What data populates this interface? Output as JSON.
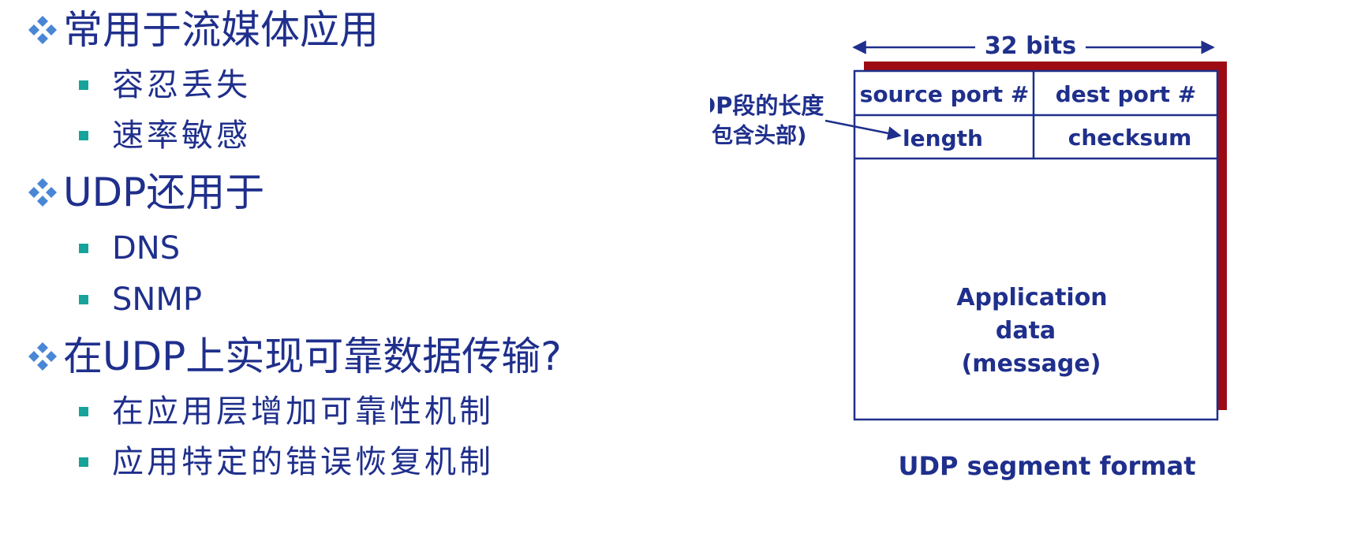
{
  "bullets": [
    {
      "text": "常用于流媒体应用",
      "children": [
        "容忍丢失",
        "速率敏感"
      ]
    },
    {
      "text": "UDP还用于",
      "children": [
        "DNS",
        "SNMP"
      ]
    },
    {
      "text": "在UDP上实现可靠数据传输?",
      "children": [
        "在应用层增加可靠性机制",
        "应用特定的错误恢复机制"
      ]
    }
  ],
  "diagram": {
    "width_label": "32 bits",
    "fields": {
      "source_port": "source port #",
      "dest_port": "dest port #",
      "length": "length",
      "checksum": "checksum"
    },
    "payload_lines": [
      "Application",
      "data",
      "(message)"
    ],
    "annotation_line1": "UDP段的长度",
    "annotation_line2": "(包含头部)",
    "caption": "UDP segment format"
  },
  "colors": {
    "text": "#1f2f8c",
    "bullet_diamond": "#4a86d6",
    "bullet_square": "#17a39b",
    "shadow": "#9c0b14",
    "box_border": "#1f2f8c"
  }
}
